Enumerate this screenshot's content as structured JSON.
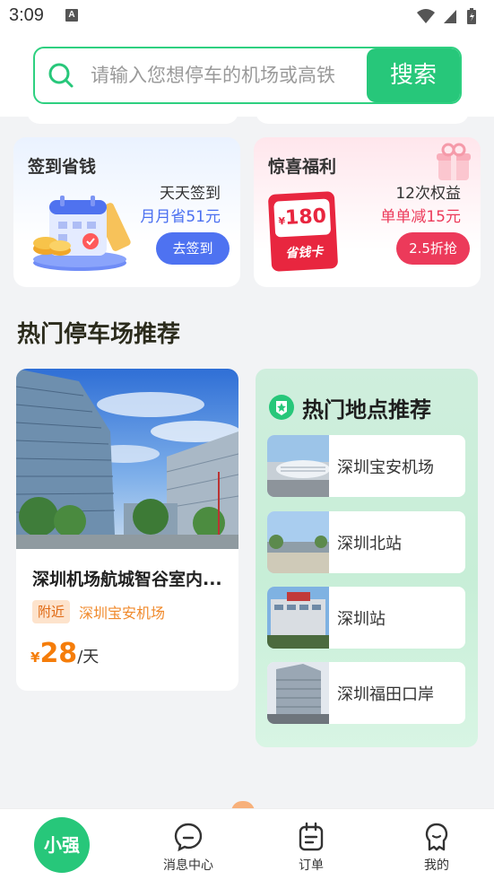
{
  "status_bar": {
    "time": "3:09",
    "notification_icon": "A"
  },
  "search": {
    "placeholder": "请输入您想停车的机场或高铁",
    "button_label": "搜索"
  },
  "promos": [
    {
      "title": "签到省钱",
      "line1": "天天签到",
      "line2": "月月省51元",
      "line2_color": "#4a6ff0",
      "button": "去签到",
      "illustration": "calendar-coins-icon"
    },
    {
      "title": "惊喜福利",
      "line1": "12次权益",
      "line2": "单单减15元",
      "line2_color": "#ec3a5a",
      "button": "2.5折抢",
      "card_value": "180",
      "card_currency": "¥",
      "card_label": "省钱卡",
      "illustration": "gift-icon"
    }
  ],
  "section_title": "热门停车场推荐",
  "parking": {
    "name": "深圳机场航城智谷室内...",
    "tag": "附近",
    "location": "深圳宝安机场",
    "price_symbol": "¥",
    "price": "28",
    "unit": "/天"
  },
  "hot_places": {
    "title": "热门地点推荐",
    "items": [
      {
        "label": "深圳宝安机场",
        "thumb": "airport-photo"
      },
      {
        "label": "深圳北站",
        "thumb": "station-photo"
      },
      {
        "label": "深圳站",
        "thumb": "station-photo"
      },
      {
        "label": "深圳福田口岸",
        "thumb": "building-photo"
      }
    ]
  },
  "bottom_nav": {
    "home": "小强",
    "items": [
      {
        "label": "消息中心",
        "icon": "message-icon"
      },
      {
        "label": "订单",
        "icon": "order-icon"
      },
      {
        "label": "我的",
        "icon": "profile-icon"
      }
    ]
  },
  "colors": {
    "brand_green": "#27c77a",
    "accent_orange": "#f57d0a",
    "accent_blue": "#4e72f1",
    "accent_red": "#ec3a5a"
  }
}
